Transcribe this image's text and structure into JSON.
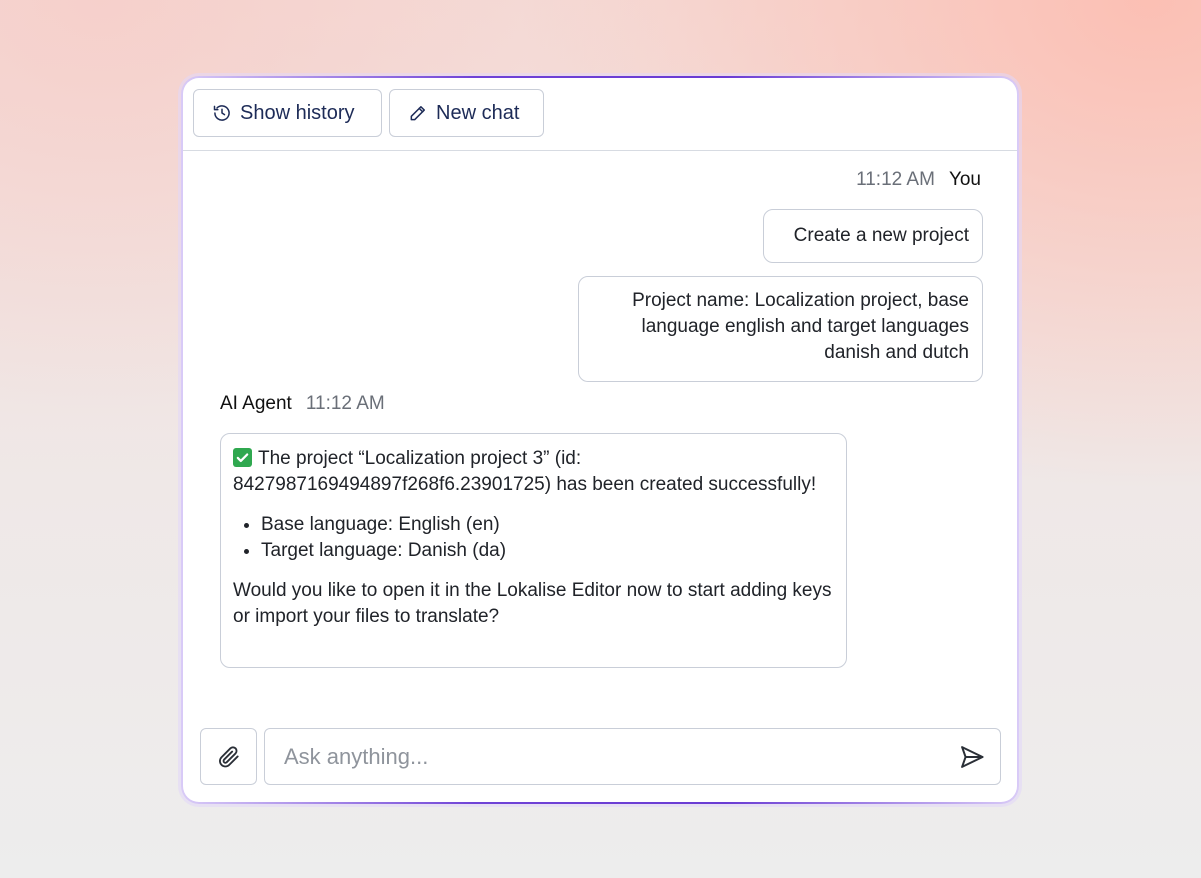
{
  "header": {
    "show_history_label": "Show history",
    "new_chat_label": "New chat",
    "icons": {
      "history": "history-icon",
      "new_chat": "pencil-icon"
    }
  },
  "messages": {
    "user": {
      "time": "11:12 AM",
      "author": "You",
      "bubbles": [
        "Create a new project",
        "Project name: Localization project, base language english and target languages danish and dutch"
      ]
    },
    "agent": {
      "author": "AI Agent",
      "time": "11:12 AM",
      "intro": "The project “Localization project 3” (id: 8427987169494897f268f6.23901725) has been created successfully!",
      "bullets": [
        "Base language: English (en)",
        "Target language: Danish (da)"
      ],
      "outro": "Would you like to open it in the Lokalise Editor now to start adding keys or import your files to translate?"
    }
  },
  "composer": {
    "placeholder": "Ask anything...",
    "icons": {
      "attach": "paperclip-icon",
      "send": "send-icon"
    }
  },
  "colors": {
    "accent_border": "#6a3bd3",
    "button_text": "#1d2b57",
    "success_check": "#2fa84f"
  }
}
